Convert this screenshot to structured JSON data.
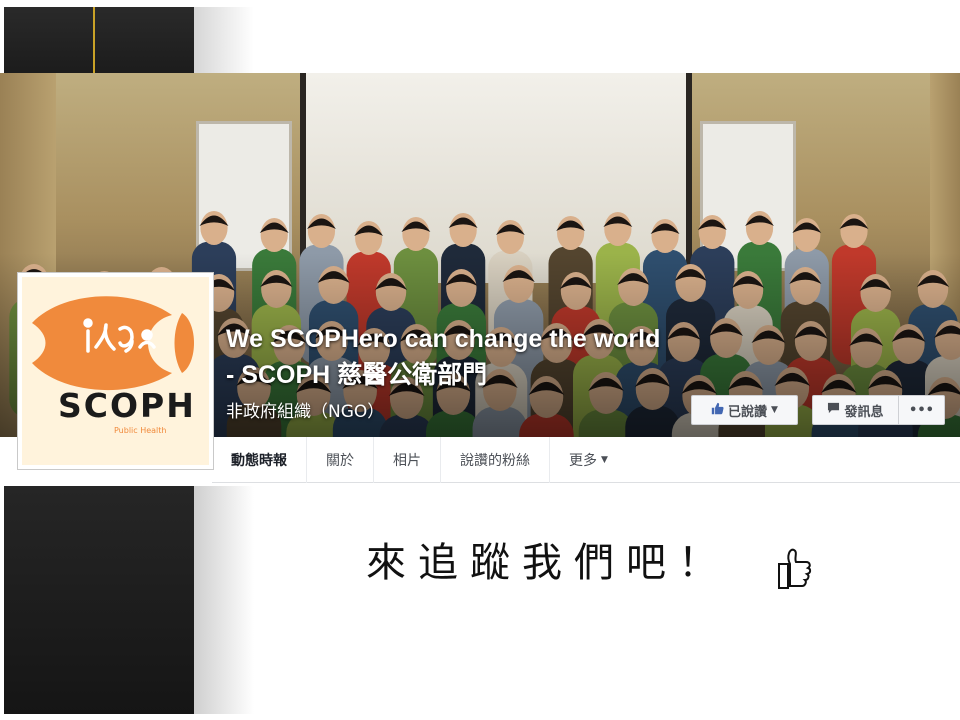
{
  "page": {
    "name": "We SCOPHero can change the world - SCOPH 慈醫公衛部門",
    "category": "非政府組織（NGO）"
  },
  "logo": {
    "wordmark": "SCOPH",
    "subtitle": "Public Health",
    "colors": {
      "orange": "#f08a3c",
      "background": "#fff3dc",
      "text": "#1b1b1b"
    }
  },
  "actions": {
    "liked_label": "已說讚",
    "message_label": "發訊息",
    "more_label": "•••"
  },
  "tabs": [
    {
      "label": "動態時報",
      "active": true
    },
    {
      "label": "關於",
      "active": false
    },
    {
      "label": "相片",
      "active": false
    },
    {
      "label": "說讚的粉絲",
      "active": false
    },
    {
      "label": "更多",
      "active": false
    }
  ],
  "slogan": "來追蹤我們吧！",
  "colors": {
    "fb_blue": "#4267b2",
    "gold_accent": "#c9a227"
  }
}
